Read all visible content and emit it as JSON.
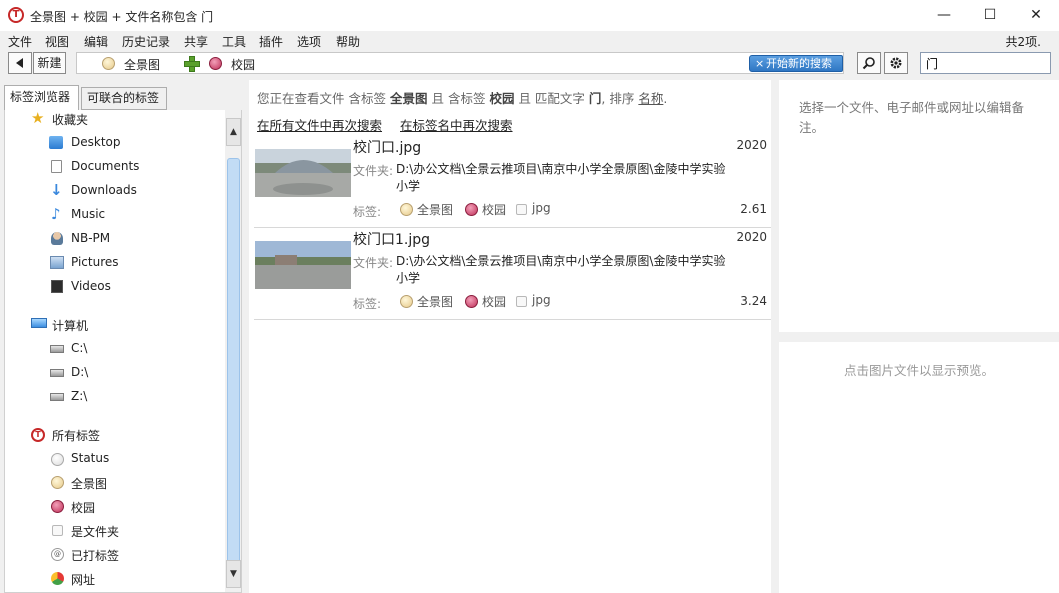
{
  "window": {
    "title": "全景图  +  校园  +  文件名称包含 门",
    "logo": "T",
    "minimize": "—",
    "maximize": "☐",
    "close": "✕"
  },
  "menu": {
    "items": [
      "文件",
      "视图",
      "编辑",
      "历史记录",
      "共享",
      "工具",
      "插件",
      "选项",
      "帮助"
    ],
    "count": "共2项."
  },
  "toolbar": {
    "new_label": "新建",
    "tags": [
      {
        "label": "全景图",
        "color": "#e6c98a"
      },
      {
        "label": "校园",
        "color": "#c0305a"
      }
    ],
    "new_search_label": "开始新的搜索",
    "new_search_x": "×",
    "search_icon": "magnifier-icon",
    "settings_icon": "gear-icon",
    "filter_value": "门"
  },
  "tabs": {
    "tag_browser": "标签浏览器",
    "combinable_tags": "可联合的标签"
  },
  "sidebar": {
    "favorites_label": "收藏夹",
    "favorites": [
      {
        "label": "Desktop",
        "icon": "desktop-folder-icon"
      },
      {
        "label": "Documents",
        "icon": "documents-icon"
      },
      {
        "label": "Downloads",
        "icon": "downloads-icon"
      },
      {
        "label": "Music",
        "icon": "music-icon"
      },
      {
        "label": "NB-PM",
        "icon": "user-icon"
      },
      {
        "label": "Pictures",
        "icon": "pictures-icon"
      },
      {
        "label": "Videos",
        "icon": "videos-icon"
      }
    ],
    "computer_label": "计算机",
    "drives": [
      "C:\\",
      "D:\\",
      "Z:\\"
    ],
    "all_tags_label": "所有标签",
    "tags": [
      {
        "label": "Status",
        "icon": "status-tag-icon"
      },
      {
        "label": "全景图",
        "icon": "panorama-tag-icon"
      },
      {
        "label": "校园",
        "icon": "campus-tag-icon"
      },
      {
        "label": "是文件夹",
        "icon": "folder-tag-icon"
      },
      {
        "label": "已打标签",
        "icon": "tagged-icon"
      },
      {
        "label": "网址",
        "icon": "web-icon"
      }
    ]
  },
  "summary": {
    "prefix": "您正在查看文件 含标签",
    "tag1": "全景图",
    "and1": "且 含标签",
    "tag2": "校园",
    "and2": "且 匹配文字",
    "text": "门",
    "sort_prefix": ", 排序",
    "sort_field": "名称",
    "period": "."
  },
  "research": {
    "all_files": "在所有文件中再次搜索",
    "tag_names": "在标签名中再次搜索"
  },
  "results": [
    {
      "name": "校门口.jpg",
      "date": "2020",
      "folder_label": "文件夹:",
      "path": "D:\\办公文档\\全景云推项目\\南京中小学全景原图\\金陵中学实验小学",
      "tags_label": "标签:",
      "tags": [
        "全景图",
        "校园",
        "jpg"
      ],
      "size": "2.61"
    },
    {
      "name": "校门口1.jpg",
      "date": "2020",
      "folder_label": "文件夹:",
      "path": "D:\\办公文档\\全景云推项目\\南京中小学全景原图\\金陵中学实验小学",
      "tags_label": "标签:",
      "tags": [
        "全景图",
        "校园",
        "jpg"
      ],
      "size": "3.24"
    }
  ],
  "right": {
    "edit_hint": "选择一个文件、电子邮件或网址以编辑备注。",
    "preview_hint": "点击图片文件以显示预览。"
  }
}
